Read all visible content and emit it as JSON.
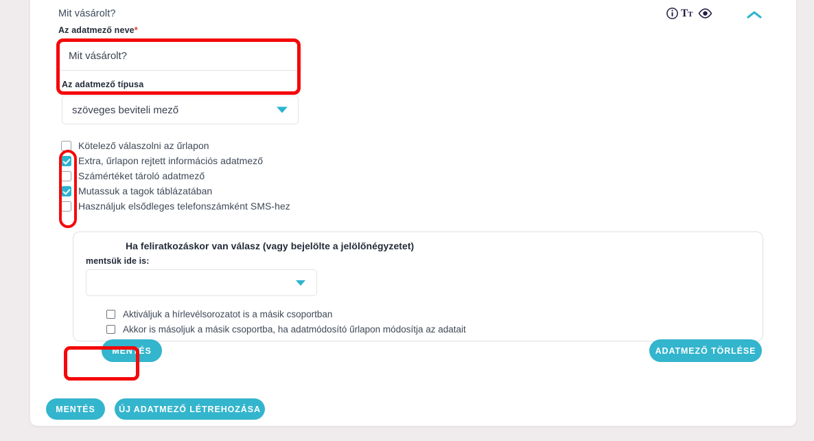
{
  "panel": {
    "title": "Mit vásárolt?",
    "icons": {
      "info": "info-circle-icon",
      "text_size": "text-size-icon",
      "visibility": "eye-icon",
      "collapse": "chevron-up-icon"
    }
  },
  "field_name": {
    "label": "Az adatmező neve",
    "required_marker": "*",
    "value": "Mit vásárolt?"
  },
  "field_type": {
    "label": "Az adatmező típusa",
    "selected": "szöveges beviteli mező"
  },
  "options": [
    {
      "label": "Kötelező válaszolni az űrlapon",
      "checked": false
    },
    {
      "label": "Extra, űrlapon rejtett információs adatmező",
      "checked": true
    },
    {
      "label": "Számértéket tároló adatmező",
      "checked": false
    },
    {
      "label": "Mutassuk a tagok táblázatában",
      "checked": true
    },
    {
      "label": "Használjuk elsődleges telefonszámként SMS-hez",
      "checked": false
    }
  ],
  "inner_panel": {
    "title": "Ha feliratkozáskor van válasz (vagy bejelölte a jelölőnégyzetet)",
    "sublabel": "mentsük ide is:",
    "select_value": "",
    "options": [
      {
        "label": "Aktiváljuk a hírlevélsorozatot is a másik csoportban",
        "checked": false
      },
      {
        "label": "Akkor is másoljuk a másik csoportba, ha adatmódosító űrlapon módosítja az adatait",
        "checked": false
      }
    ]
  },
  "buttons": {
    "save_inner": "MENTÉS",
    "delete_field": "ADATMEZŐ TÖRLÉSE",
    "save_bottom": "MENTÉS",
    "new_field": "ÚJ ADATMEZŐ LÉTREHOZÁSA"
  },
  "colors": {
    "accent": "#33b5cd",
    "annotation": "#f50808",
    "text": "#3d4856",
    "page_bg": "#f0ecee"
  }
}
